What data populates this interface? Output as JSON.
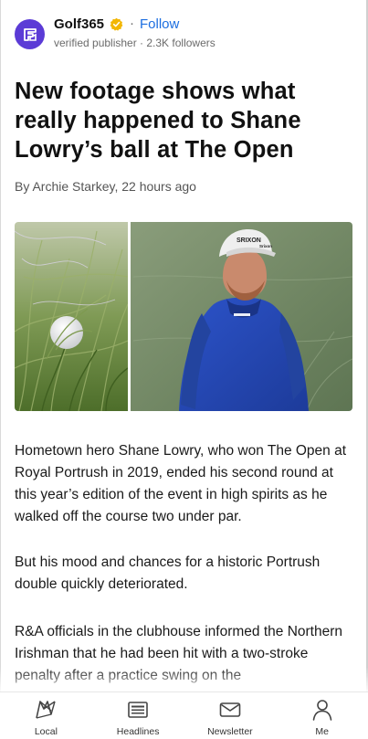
{
  "publisher": {
    "name": "Golf365",
    "separator": "·",
    "follow_label": "Follow",
    "meta": "verified publisher · 2.3K followers",
    "logo_color": "#5b3bd6",
    "verified_icon": "verified-badge-icon",
    "verified_color": "#f2b705"
  },
  "article": {
    "headline": "New footage shows what really happened to Shane Lowry’s ball at The Open",
    "byline": "By Archie Starkey, 22 hours ago",
    "paragraphs": [
      "Hometown hero Shane Lowry, who won The Open at Royal Portrush in 2019, ended his second round at this year’s edition of the event in high spirits as he walked off the course two under par.",
      "But his mood and chances for a historic Portrush double quickly deteriorated.",
      "R&A officials in the clubhouse informed the Northern Irishman that he had been hit with a two-stroke penalty after a practice swing on the"
    ]
  },
  "hero_image": {
    "left": "golf ball in rough grass",
    "right": "golfer in blue hoodie and white cap",
    "cap_text": "SRIXON",
    "cap_logo": "Srixon"
  },
  "bottom_nav": {
    "items": [
      {
        "label": "Local",
        "icon": "local-map-icon"
      },
      {
        "label": "Headlines",
        "icon": "headlines-icon"
      },
      {
        "label": "Newsletter",
        "icon": "newsletter-mail-icon"
      },
      {
        "label": "Me",
        "icon": "profile-person-icon"
      }
    ]
  }
}
